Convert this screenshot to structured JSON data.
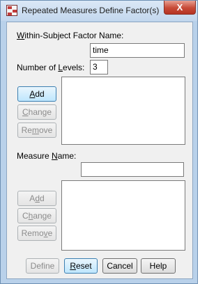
{
  "window": {
    "title": "Repeated Measures Define Factor(s)",
    "close_glyph": "X"
  },
  "factor": {
    "label_first": "W",
    "label_rest": "ithin-Subject Factor Name:",
    "name_value": "time",
    "levels_label_a": "Number of ",
    "levels_label_u": "L",
    "levels_label_b": "evels:",
    "levels_value": "3",
    "buttons": {
      "add_u": "A",
      "add_rest": "dd",
      "change_u": "C",
      "change_rest": "hange",
      "remove_pre": "Re",
      "remove_u": "m",
      "remove_rest": "ove"
    }
  },
  "measure": {
    "label_a": "Measure ",
    "label_u": "N",
    "label_b": "ame:",
    "name_value": "",
    "buttons": {
      "add_pre": "A",
      "add_u": "d",
      "add_rest": "d",
      "change_pre": "C",
      "change_u": "h",
      "change_rest": "ange",
      "remove_pre": "Remo",
      "remove_u": "v",
      "remove_rest": "e"
    }
  },
  "footer": {
    "define": "Define",
    "reset_u": "R",
    "reset_rest": "eset",
    "cancel": "Cancel",
    "help": "Help"
  }
}
